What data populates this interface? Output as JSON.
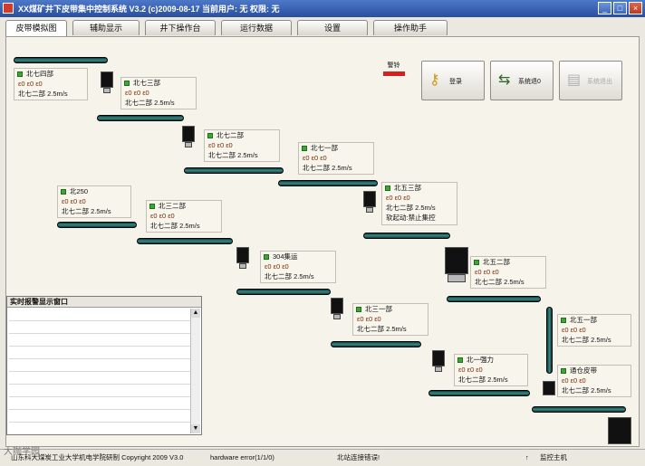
{
  "window": {
    "title": "XX煤矿井下皮带集中控制系统  V3.2  (c)2009-08-17   当前用户: 无    权限: 无",
    "min_label": "_",
    "max_label": "□",
    "close_label": "×"
  },
  "tabs": [
    {
      "label": "皮带模拟图"
    },
    {
      "label": "辅助显示"
    },
    {
      "label": "井下操作台"
    },
    {
      "label": "运行数据"
    },
    {
      "label": "设置"
    },
    {
      "label": "操作助手"
    }
  ],
  "alarm": {
    "label": "警铃"
  },
  "toolbar": {
    "login": {
      "icon": "key-icon",
      "label": "登录"
    },
    "system": {
      "icon": "arrows-icon",
      "label": "系统退0"
    },
    "disabled": {
      "icon": "doc-icon",
      "label": "系统退出"
    }
  },
  "counter_row": "ε0  ε0  ε0",
  "belts": [
    {
      "name": "北七四部",
      "speed": "北七二部 2.5m/s"
    },
    {
      "name": "北七三部",
      "speed": "北七二部 2.5m/s"
    },
    {
      "name": "北七二部",
      "speed": "北七二部 2.5m/s"
    },
    {
      "name": "北七一部",
      "speed": "北七二部 2.5m/s"
    },
    {
      "name": "北五三部",
      "speed": "北七二部 2.5m/s",
      "extra": "软起动:禁止集控"
    },
    {
      "name": "北250",
      "speed": "北七二部 2.5m/s"
    },
    {
      "name": "北三二部",
      "speed": "北七二部 2.5m/s"
    },
    {
      "name": "304集运",
      "speed": "北七二部 2.5m/s"
    },
    {
      "name": "北五二部",
      "speed": "北七二部 2.5m/s"
    },
    {
      "name": "北三一部",
      "speed": "北七二部 2.5m/s"
    },
    {
      "name": "北一强力",
      "speed": "北七二部 2.5m/s"
    },
    {
      "name": "北五一部",
      "speed": "北七二部 2.5m/s"
    },
    {
      "name": "通仓皮带",
      "speed": "北七二部 2.5m/s"
    }
  ],
  "realtime": {
    "title": "实时报警显示窗口",
    "up": "▲",
    "down": "▼"
  },
  "status": {
    "left": "山东科大煤炭工业大学机电学院研制 Copyright 2009 V3.0",
    "error": "hardware error(1/1/0)",
    "comm": "北站连接错误!",
    "marker": "↑",
    "host": "监控主机"
  },
  "watermark": "大咖学园",
  "colors": {
    "title_bar": "#2f58a8",
    "belt": "#2c6e6c",
    "status_led": "#3aa832",
    "alarm": "#d62020"
  }
}
